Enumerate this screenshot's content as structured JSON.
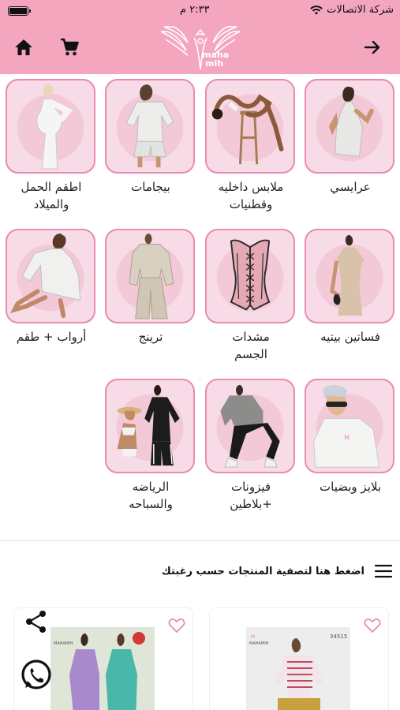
{
  "status_bar": {
    "carrier": "شركة الاتصالات",
    "time": "٢:٣٣ م"
  },
  "header": {
    "logo_text_line1": "maha",
    "logo_text_line2": "mih",
    "icons": [
      "back-arrow-icon",
      "cart-icon",
      "home-icon"
    ]
  },
  "categories": [
    {
      "label_line1": "عرايسي",
      "label_line2": ""
    },
    {
      "label_line1": "ملابس داخليه",
      "label_line2": "وقطنيات"
    },
    {
      "label_line1": "بيجامات",
      "label_line2": ""
    },
    {
      "label_line1": "اطقم الحمل",
      "label_line2": "والميلاد"
    },
    {
      "label_line1": "فساتين بيتيه",
      "label_line2": ""
    },
    {
      "label_line1": "مشدات",
      "label_line2": "الجسم"
    },
    {
      "label_line1": "ترينج",
      "label_line2": ""
    },
    {
      "label_line1": "أرواب + طقم",
      "label_line2": ""
    },
    {
      "label_line1": "بلايز وبضيات",
      "label_line2": ""
    },
    {
      "label_line1": "فيزونات",
      "label_line2": "+بلاطين"
    },
    {
      "label_line1": "الرياضه",
      "label_line2": "والسباحه"
    }
  ],
  "filter": {
    "label": "اضغط هنا لتصفية المنتجات حسب رغبتك"
  },
  "products": [
    {
      "brand": "MAHAMIH",
      "code": "34515"
    },
    {
      "brand": "MAHAMIH",
      "code": ""
    }
  ],
  "colors": {
    "accent_pink": "#f4a6bf",
    "border_pink": "#e98ab0",
    "tile_bg": "#f7dce7"
  }
}
